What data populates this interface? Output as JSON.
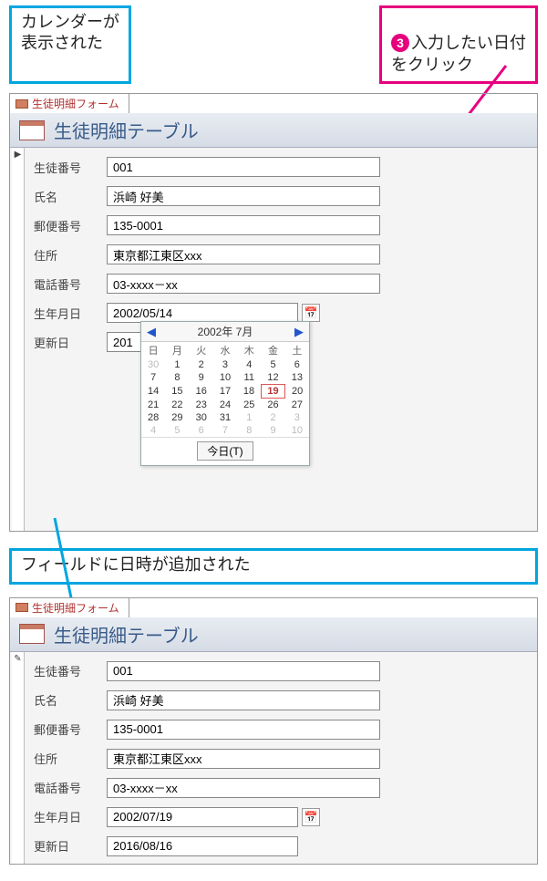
{
  "callouts": {
    "calendar_shown": "カレンダーが\n表示された",
    "step3": "入力したい日付\nをクリック",
    "step3_num": "❸",
    "field_added": "フィールドに日時が追加された"
  },
  "tab": {
    "label": "生徒明細フォーム"
  },
  "header": {
    "title": "生徒明細テーブル"
  },
  "labels": {
    "student_id": "生徒番号",
    "name": "氏名",
    "postal": "郵便番号",
    "address": "住所",
    "phone": "電話番号",
    "birth": "生年月日",
    "updated": "更新日"
  },
  "form_before": {
    "student_id": "001",
    "name": "浜崎 好美",
    "postal": "135-0001",
    "address": "東京都江東区xxx",
    "phone": "03-xxxx－xx",
    "birth": "2002/05/14",
    "updated": "201"
  },
  "form_after": {
    "student_id": "001",
    "name": "浜崎 好美",
    "postal": "135-0001",
    "address": "東京都江東区xxx",
    "phone": "03-xxxx－xx",
    "birth": "2002/07/19",
    "updated": "2016/08/16"
  },
  "calendar": {
    "title": "2002年 7月",
    "dow": [
      "日",
      "月",
      "火",
      "水",
      "木",
      "金",
      "土"
    ],
    "weeks": [
      [
        {
          "d": 30,
          "o": true
        },
        {
          "d": 1
        },
        {
          "d": 2
        },
        {
          "d": 3
        },
        {
          "d": 4
        },
        {
          "d": 5
        },
        {
          "d": 6
        }
      ],
      [
        {
          "d": 7
        },
        {
          "d": 8
        },
        {
          "d": 9
        },
        {
          "d": 10
        },
        {
          "d": 11
        },
        {
          "d": 12
        },
        {
          "d": 13
        }
      ],
      [
        {
          "d": 14
        },
        {
          "d": 15
        },
        {
          "d": 16
        },
        {
          "d": 17
        },
        {
          "d": 18
        },
        {
          "d": 19,
          "t": true
        },
        {
          "d": 20
        }
      ],
      [
        {
          "d": 21
        },
        {
          "d": 22
        },
        {
          "d": 23
        },
        {
          "d": 24
        },
        {
          "d": 25
        },
        {
          "d": 26
        },
        {
          "d": 27
        }
      ],
      [
        {
          "d": 28
        },
        {
          "d": 29
        },
        {
          "d": 30
        },
        {
          "d": 31
        },
        {
          "d": 1,
          "o": true
        },
        {
          "d": 2,
          "o": true
        },
        {
          "d": 3,
          "o": true
        }
      ],
      [
        {
          "d": 4,
          "o": true
        },
        {
          "d": 5,
          "o": true
        },
        {
          "d": 6,
          "o": true
        },
        {
          "d": 7,
          "o": true
        },
        {
          "d": 8,
          "o": true
        },
        {
          "d": 9,
          "o": true
        },
        {
          "d": 10,
          "o": true
        }
      ]
    ],
    "today_btn": "今日(T)"
  },
  "record_marker": {
    "before": "▶",
    "after": "✎"
  }
}
